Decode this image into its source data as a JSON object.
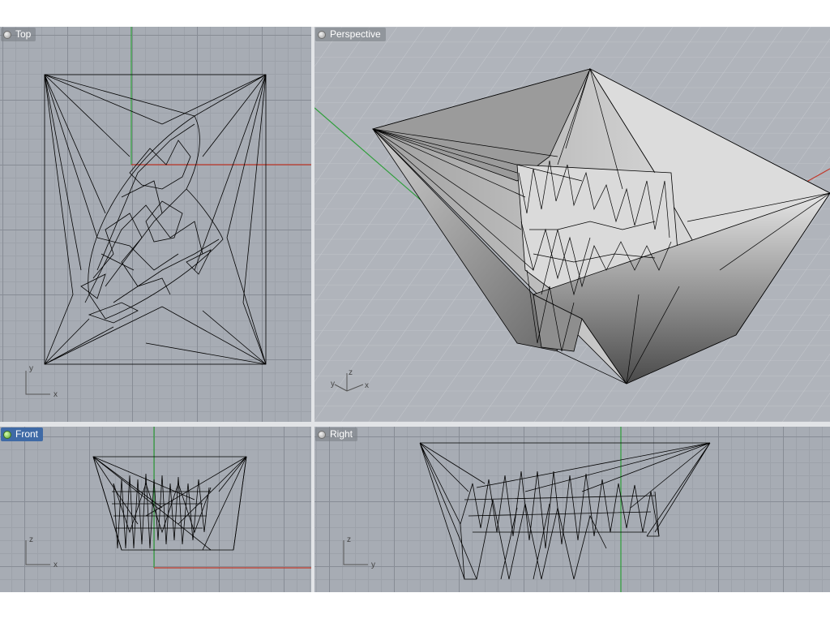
{
  "viewports": {
    "top": {
      "label": "Top",
      "active": false,
      "axis_h": "x",
      "axis_v": "y"
    },
    "perspective": {
      "label": "Perspective",
      "active": false,
      "axis_h": "x",
      "axis_v": "z",
      "axis_d": "y"
    },
    "front": {
      "label": "Front",
      "active": true,
      "axis_h": "x",
      "axis_v": "z"
    },
    "right": {
      "label": "Right",
      "active": false,
      "axis_h": "y",
      "axis_v": "z"
    }
  },
  "colors": {
    "x_axis": "#c0392b",
    "y_axis": "#2e9e3a",
    "wire": "#000000",
    "active_tab": "#3f6aa6"
  },
  "icons": [
    "viewport-shade-icon",
    "axis-gizmo-icon"
  ]
}
